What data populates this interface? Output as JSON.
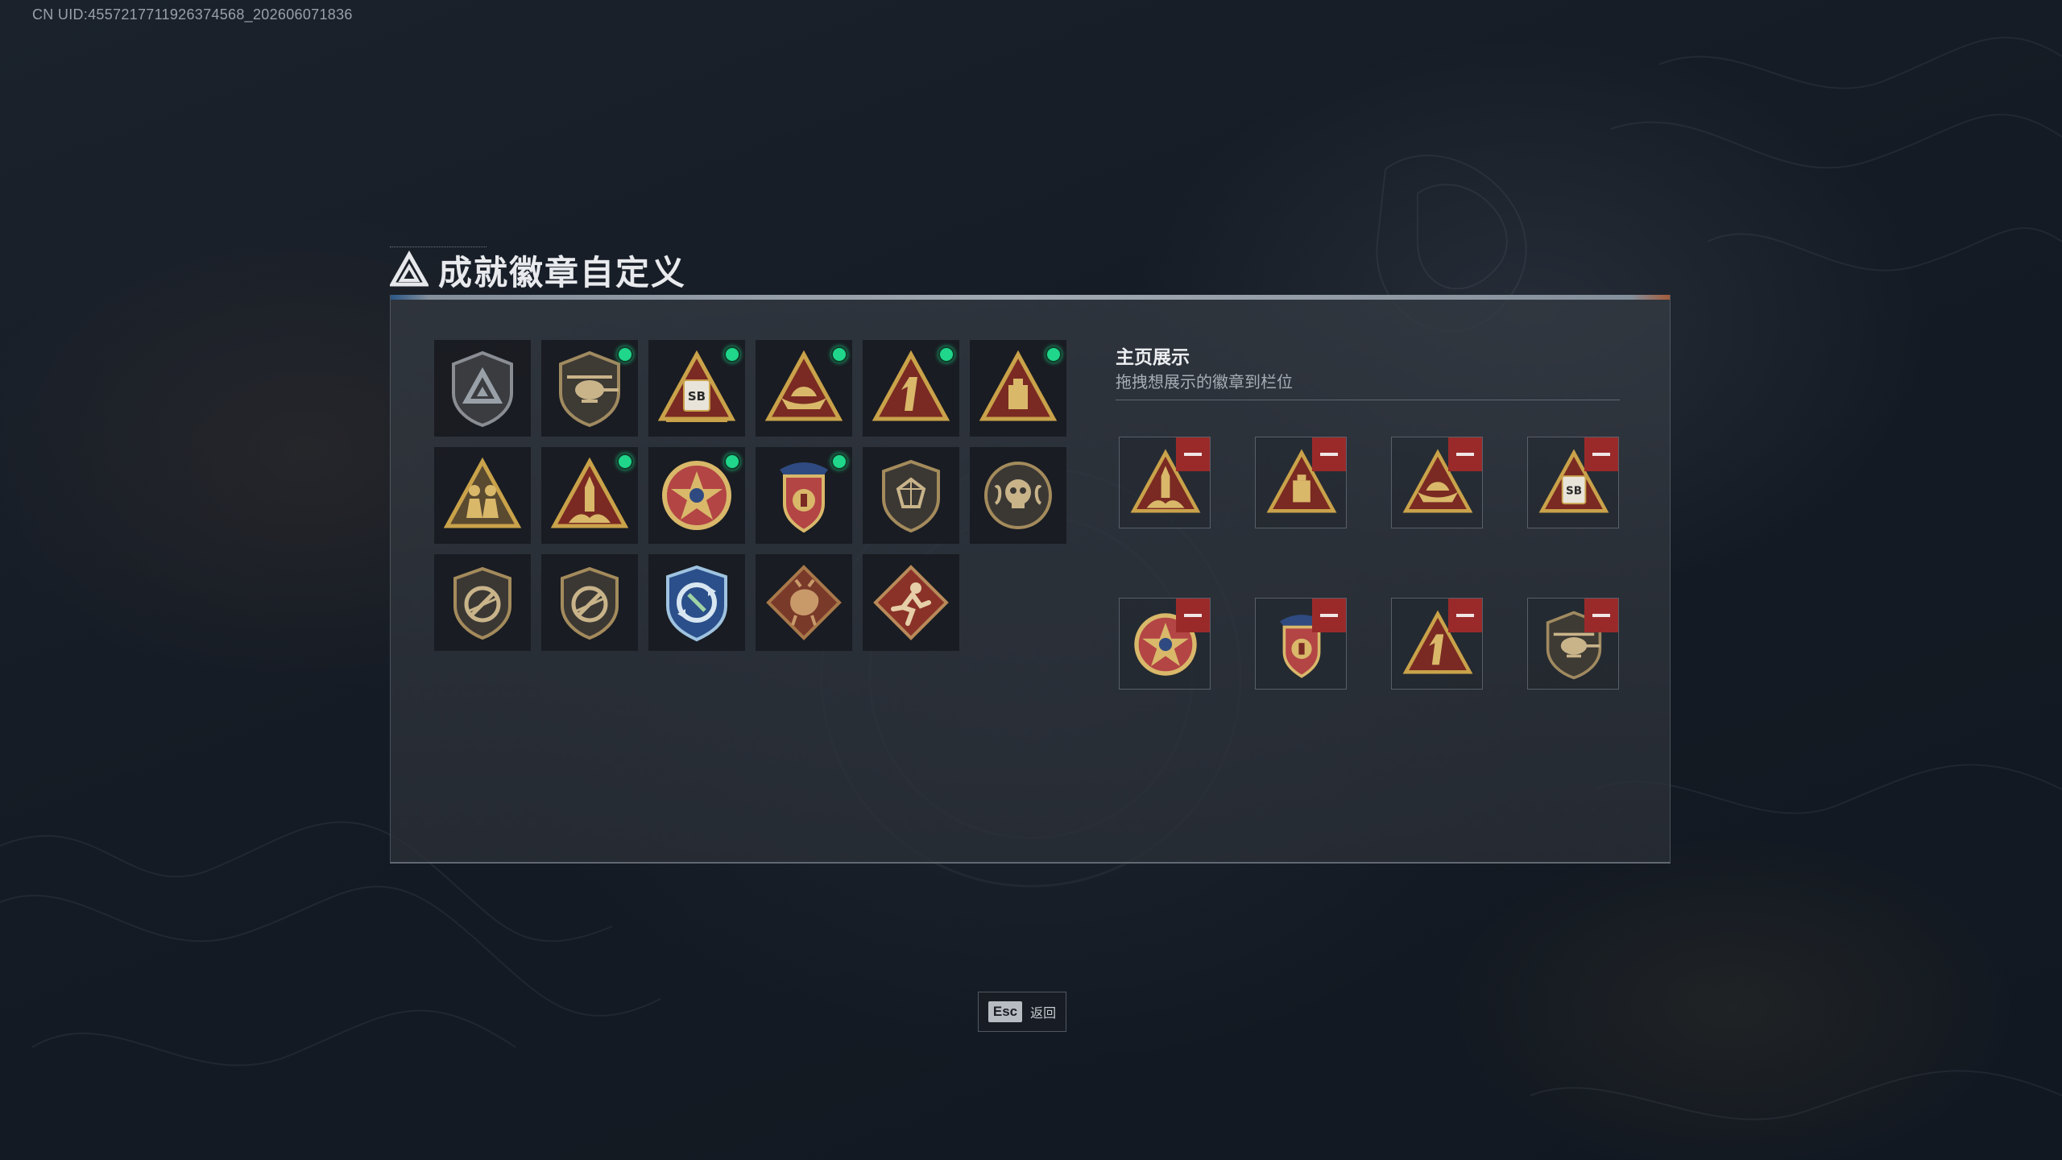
{
  "uid_text": "CN UID:4557217711926374568_202606071836",
  "page_title": "成就徽章自定义",
  "showcase": {
    "title": "主页展示",
    "subtitle": "拖拽想展示的徽章到栏位"
  },
  "colors": {
    "accent_green": "#20d68a",
    "remove_red": "#9a2a2a",
    "badge_gold": "#c9a24a",
    "badge_red": "#7a2a22"
  },
  "badges": [
    {
      "icon": "gray-triangle-shield-badge-icon",
      "new": false
    },
    {
      "icon": "helicopter-shield-badge-icon",
      "new": true
    },
    {
      "icon": "sb-document-triangle-badge-icon",
      "new": true
    },
    {
      "icon": "boat-triangle-badge-icon",
      "new": true
    },
    {
      "icon": "number-one-triangle-badge-icon",
      "new": true
    },
    {
      "icon": "box-triangle-badge-icon",
      "new": true
    },
    {
      "icon": "soldiers-triangle-badge-icon",
      "new": false
    },
    {
      "icon": "rocket-launch-triangle-badge-icon",
      "new": true
    },
    {
      "icon": "star-medal-badge-icon",
      "new": true
    },
    {
      "icon": "eagle-crest-badge-icon",
      "new": true
    },
    {
      "icon": "gem-shield-badge-icon",
      "new": false
    },
    {
      "icon": "skull-emblem-badge-icon",
      "new": false
    },
    {
      "icon": "no-rifle-shield-badge-icon",
      "new": false
    },
    {
      "icon": "no-rifle-shield-badge-icon",
      "new": false
    },
    {
      "icon": "blue-cycle-shield-badge-icon",
      "new": false
    },
    {
      "icon": "dragon-diamond-badge-icon",
      "new": false
    },
    {
      "icon": "runner-diamond-badge-icon",
      "new": false
    }
  ],
  "showcase_slots": [
    {
      "icon": "rocket-launch-triangle-badge-icon"
    },
    {
      "icon": "box-triangle-badge-icon"
    },
    {
      "icon": "boat-triangle-badge-icon"
    },
    {
      "icon": "sb-document-triangle-badge-icon"
    },
    {
      "icon": "star-medal-badge-icon"
    },
    {
      "icon": "eagle-crest-badge-icon"
    },
    {
      "icon": "number-one-triangle-badge-icon"
    },
    {
      "icon": "helicopter-shield-badge-icon"
    }
  ],
  "footer": {
    "esc_key": "Esc",
    "back_label": "返回"
  }
}
